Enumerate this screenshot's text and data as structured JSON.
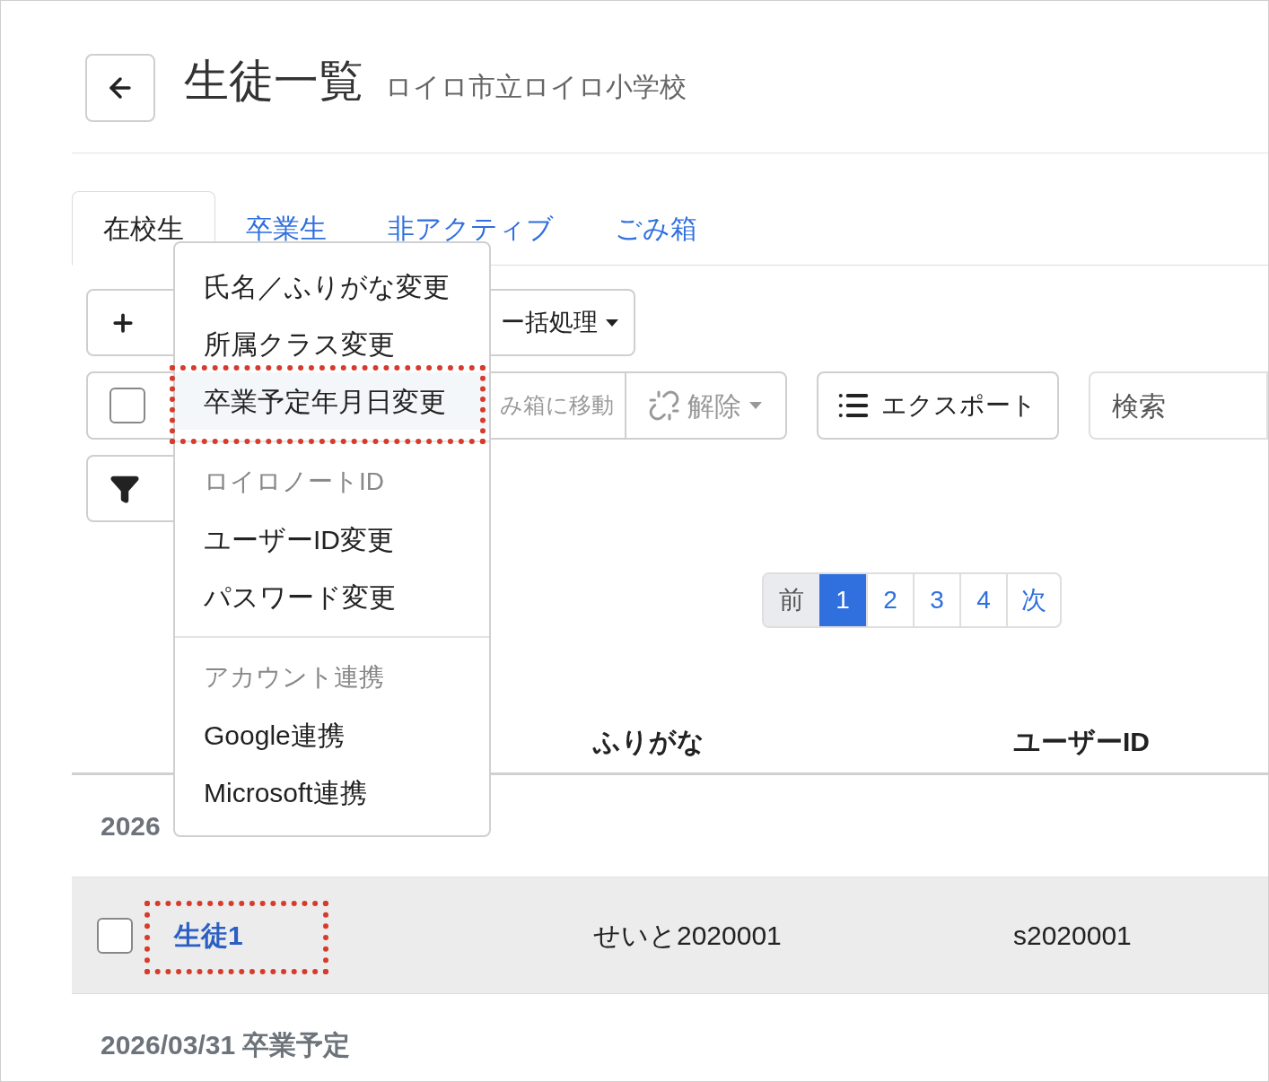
{
  "header": {
    "title": "生徒一覧",
    "subtitle": "ロイロ市立ロイロ小学校"
  },
  "tabs": [
    {
      "label": "在校生",
      "selected": true
    },
    {
      "label": "卒業生",
      "selected": false
    },
    {
      "label": "非アクティブ",
      "selected": false
    },
    {
      "label": "ごみ箱",
      "selected": false
    }
  ],
  "toolbar": {
    "bulk_button": "ー括処理",
    "select_all_checked": false,
    "trash_button": "み箱に移動",
    "unlink_button": "解除",
    "export_button": "エクスポート",
    "search_placeholder": "検索"
  },
  "pagination": {
    "prev": "前",
    "next": "次",
    "pages": [
      {
        "label": "1",
        "selected": true
      },
      {
        "label": "2",
        "selected": false
      },
      {
        "label": "3",
        "selected": false
      },
      {
        "label": "4",
        "selected": false
      }
    ]
  },
  "table": {
    "columns": [
      "ふりがな",
      "ユーザーID"
    ],
    "groups": [
      {
        "label": "2026",
        "rows": [
          {
            "name": "生徒1",
            "furigana": "せいと2020001",
            "user_id": "s2020001",
            "checked": false,
            "annotated": true
          }
        ]
      },
      {
        "label": "2026/03/31 卒業予定"
      }
    ]
  },
  "dropdown": [
    {
      "kind": "item",
      "label": "氏名／ふりがな変更",
      "selected": false,
      "annotated": false
    },
    {
      "kind": "item",
      "label": "所属クラス変更",
      "selected": false,
      "annotated": false
    },
    {
      "kind": "item",
      "label": "卒業予定年月日変更",
      "selected": true,
      "annotated": true
    },
    {
      "kind": "divider"
    },
    {
      "kind": "header",
      "label": "ロイロノートID"
    },
    {
      "kind": "item",
      "label": "ユーザーID変更",
      "selected": false,
      "annotated": false
    },
    {
      "kind": "item",
      "label": "パスワード変更",
      "selected": false,
      "annotated": false
    },
    {
      "kind": "divider"
    },
    {
      "kind": "header",
      "label": "アカウント連携"
    },
    {
      "kind": "item",
      "label": "Google連携",
      "selected": false,
      "annotated": false
    },
    {
      "kind": "item",
      "label": "Microsoft連携",
      "selected": false,
      "annotated": false
    }
  ]
}
